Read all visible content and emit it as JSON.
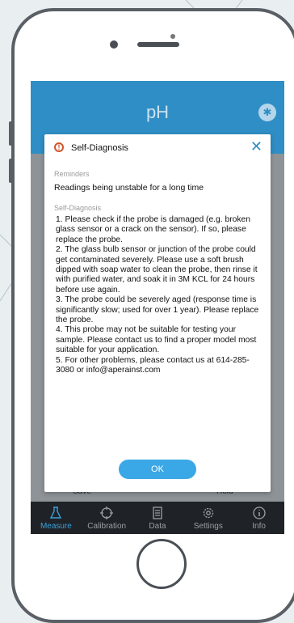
{
  "app": {
    "title": "pH",
    "bluetooth_icon": "bluetooth-icon",
    "save_label": "Save",
    "hold_label": "Hold"
  },
  "dialog": {
    "icon": "warning-icon",
    "title": "Self-Diagnosis",
    "close_icon": "close-icon",
    "reminders_label": "Reminders",
    "reminder_text": "Readings being unstable for a long time",
    "self_diagnosis_label": "Self-Diagnosis",
    "items": [
      "1.    Please check if the probe is damaged (e.g. broken glass sensor or a crack on the sensor). If so, please replace the probe.",
      "2.    The glass bulb sensor or junction of the probe could get contaminated severely. Please use a soft brush dipped with soap water to clean the probe, then rinse it with purified water, and soak it in 3M KCL for 24 hours before use again.",
      "3.    The probe could be severely aged (response time is significantly slow; used for over 1 year). Please replace the probe.",
      "4. This probe may not be suitable for testing your sample. Please contact us to find a proper model most suitable for your application.",
      "5.    For other problems, please contact us at 614-285-3080 or info@aperainst.com"
    ],
    "ok_label": "OK"
  },
  "tabs": [
    {
      "label": "Measure",
      "icon": "flask-icon",
      "active": true
    },
    {
      "label": "Calibration",
      "icon": "crosshair-icon",
      "active": false
    },
    {
      "label": "Data",
      "icon": "document-icon",
      "active": false
    },
    {
      "label": "Settings",
      "icon": "gear-icon",
      "active": false
    },
    {
      "label": "Info",
      "icon": "info-icon",
      "active": false
    }
  ],
  "colors": {
    "accent": "#3aa7e6",
    "header": "#2f8ec5",
    "warning": "#d0552b",
    "tabbar": "#1f2226"
  }
}
